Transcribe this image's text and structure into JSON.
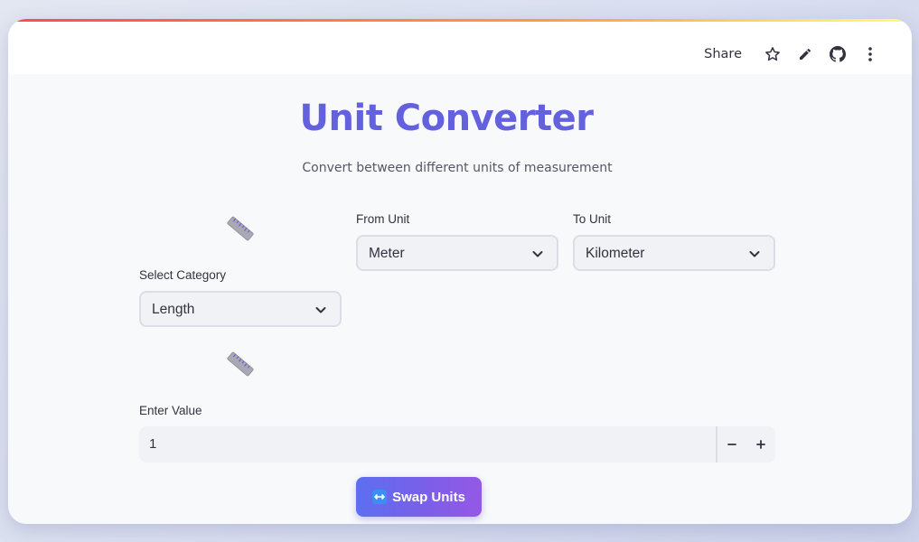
{
  "header": {
    "share_label": "Share",
    "icons": [
      "star-icon",
      "pencil-icon",
      "github-icon",
      "kebab-menu-icon"
    ]
  },
  "title": "Unit Converter",
  "subtitle": "Convert between different units of measurement",
  "category": {
    "label": "Select Category",
    "value": "Length",
    "icon": "ruler-icon"
  },
  "from_unit": {
    "label": "From Unit",
    "value": "Meter"
  },
  "to_unit": {
    "label": "To Unit",
    "value": "Kilometer"
  },
  "value_input": {
    "label": "Enter Value",
    "value": "1",
    "decrement_symbol": "−",
    "increment_symbol": "+"
  },
  "swap_button": {
    "label": "Swap Units",
    "icon": "left-right-arrow-icon"
  },
  "colors": {
    "title": "#6461de",
    "button_gradient_start": "#5c6ff0",
    "button_gradient_end": "#9458e6",
    "input_bg": "#f0f2f6"
  }
}
